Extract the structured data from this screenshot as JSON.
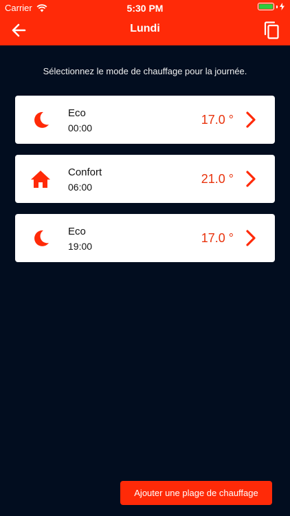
{
  "status_bar": {
    "carrier": "Carrier",
    "time": "5:30 PM"
  },
  "nav": {
    "title": "Lundi",
    "back_icon": "arrow-left-icon",
    "copy_icon": "copy-icon"
  },
  "instruction": "Sélectionnez le mode de chauffage pour la journée.",
  "slots": [
    {
      "mode": "Eco",
      "time": "00:00",
      "temperature": "17.0 °",
      "icon": "moon-icon"
    },
    {
      "mode": "Confort",
      "time": "06:00",
      "temperature": "21.0 °",
      "icon": "home-icon"
    },
    {
      "mode": "Eco",
      "time": "19:00",
      "temperature": "17.0 °",
      "icon": "moon-icon"
    }
  ],
  "add_button": "Ajouter une plage de chauffage",
  "colors": {
    "accent": "#ff2a08",
    "background": "#020d1f",
    "temperature": "#e8320c",
    "card": "#ffffff"
  }
}
